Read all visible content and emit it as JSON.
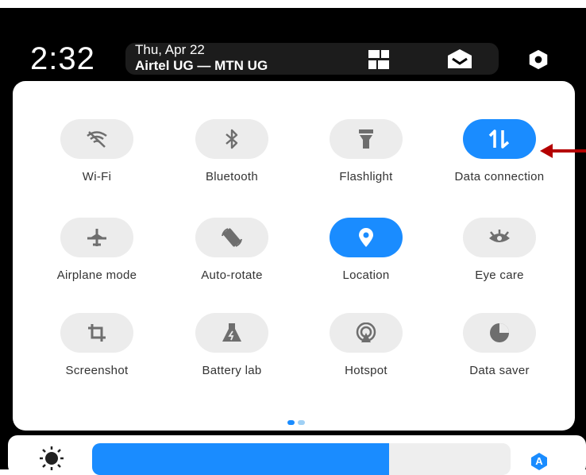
{
  "status_bar": {
    "time": "2:32",
    "date": "Thu, Apr 22",
    "carrier": "Airtel UG — MTN UG",
    "icons": [
      "grid-icon",
      "inbox-icon",
      "settings-gear-icon"
    ]
  },
  "quick_settings": {
    "tiles": [
      {
        "id": "wifi",
        "label": "Wi-Fi",
        "icon": "wifi-off-icon",
        "active": false
      },
      {
        "id": "bluetooth",
        "label": "Bluetooth",
        "icon": "bluetooth-icon",
        "active": false
      },
      {
        "id": "flashlight",
        "label": "Flashlight",
        "icon": "flashlight-icon",
        "active": false
      },
      {
        "id": "data",
        "label": "Data connection",
        "icon": "data-arrows-icon",
        "active": true
      },
      {
        "id": "airplane",
        "label": "Airplane mode",
        "icon": "airplane-icon",
        "active": false
      },
      {
        "id": "autorotate",
        "label": "Auto-rotate",
        "icon": "rotate-icon",
        "active": false
      },
      {
        "id": "location",
        "label": "Location",
        "icon": "location-pin-icon",
        "active": true
      },
      {
        "id": "eyecare",
        "label": "Eye care",
        "icon": "eye-icon",
        "active": false
      },
      {
        "id": "screenshot",
        "label": "Screenshot",
        "icon": "crop-icon",
        "active": false
      },
      {
        "id": "batterylab",
        "label": "Battery lab",
        "icon": "flask-icon",
        "active": false
      },
      {
        "id": "hotspot",
        "label": "Hotspot",
        "icon": "hotspot-icon",
        "active": false
      },
      {
        "id": "datasaver",
        "label": "Data saver",
        "icon": "data-saver-icon",
        "active": false
      }
    ],
    "page_indicator": {
      "pages": 2,
      "current": 1
    }
  },
  "brightness": {
    "level": 0.71,
    "auto_label": "A"
  },
  "colors": {
    "accent": "#1a8cff",
    "tile_inactive": "#ececec",
    "icon_inactive": "#6e6e6e",
    "annotation_arrow": "#b40000"
  }
}
